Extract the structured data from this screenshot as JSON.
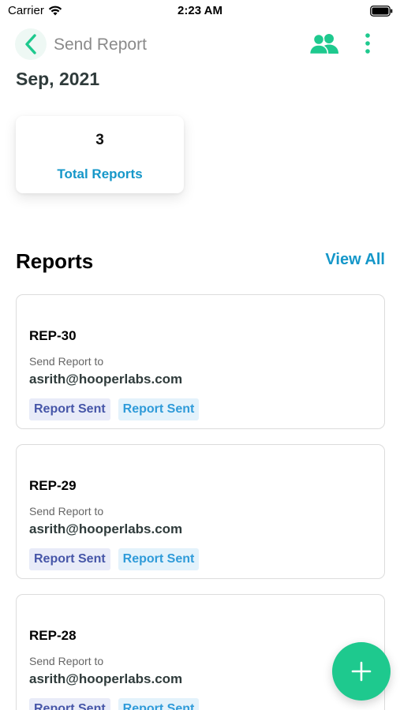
{
  "status_bar": {
    "carrier": "Carrier",
    "time": "2:23 AM"
  },
  "header": {
    "title": "Send Report",
    "back_icon": "chevron-left-icon",
    "people_icon": "users-icon",
    "more_icon": "more-vertical-icon"
  },
  "period": "Sep, 2021",
  "summary": {
    "value": "3",
    "label": "Total Reports"
  },
  "reports_section": {
    "title": "Reports",
    "view_all": "View All"
  },
  "reports": [
    {
      "id": "REP-30",
      "subtitle": "Send Report to",
      "email": "asrith@hooperlabs.com",
      "badge_1": "Report Sent",
      "badge_2": "Report Sent"
    },
    {
      "id": "REP-29",
      "subtitle": "Send Report to",
      "email": "asrith@hooperlabs.com",
      "badge_1": "Report Sent",
      "badge_2": "Report Sent"
    },
    {
      "id": "REP-28",
      "subtitle": "Send Report to",
      "email": "asrith@hooperlabs.com",
      "badge_1": "Report Sent",
      "badge_2": "Report Sent"
    }
  ],
  "fab_icon": "plus-icon",
  "colors": {
    "accent_green": "#1ec98e",
    "accent_blue": "#1597c9",
    "badge_indigo": "#4656a8",
    "badge_sky": "#2f9bd9"
  }
}
